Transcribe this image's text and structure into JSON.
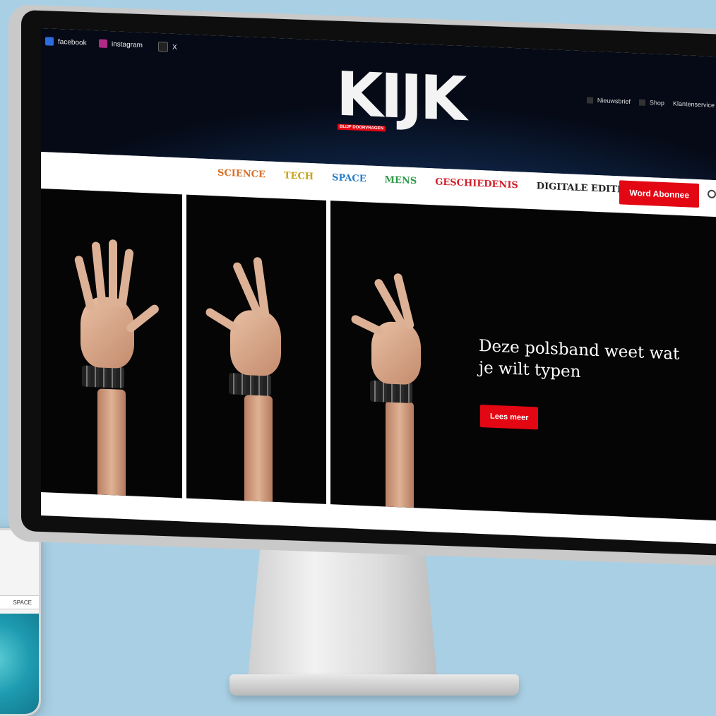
{
  "site": {
    "logo": "KIJK",
    "logo_tag": "BLIJF DOORVRAGEN"
  },
  "social": {
    "facebook": "facebook",
    "instagram": "instagram",
    "x": "X"
  },
  "top_links": [
    "Nieuwsbrief",
    "Shop",
    "Klantenservice"
  ],
  "nav": {
    "items": [
      {
        "label": "SCIENCE",
        "color": "#d8702a"
      },
      {
        "label": "TECH",
        "color": "#c9a21a"
      },
      {
        "label": "SPACE",
        "color": "#2a7fc9"
      },
      {
        "label": "MENS",
        "color": "#2e9a4a"
      },
      {
        "label": "GESCHIEDENIS",
        "color": "#d21f2b"
      },
      {
        "label": "DIGITALE EDITIES",
        "color": "#222222"
      }
    ],
    "subscribe_label": "Word Abonnee"
  },
  "hero": {
    "headline": "Deze polsband weet wat je wilt typen",
    "button_label": "Lees meer"
  },
  "phone": {
    "nav_label": "SPACE"
  },
  "colors": {
    "brand_red": "#e30613",
    "background": "#a9cfe4"
  }
}
